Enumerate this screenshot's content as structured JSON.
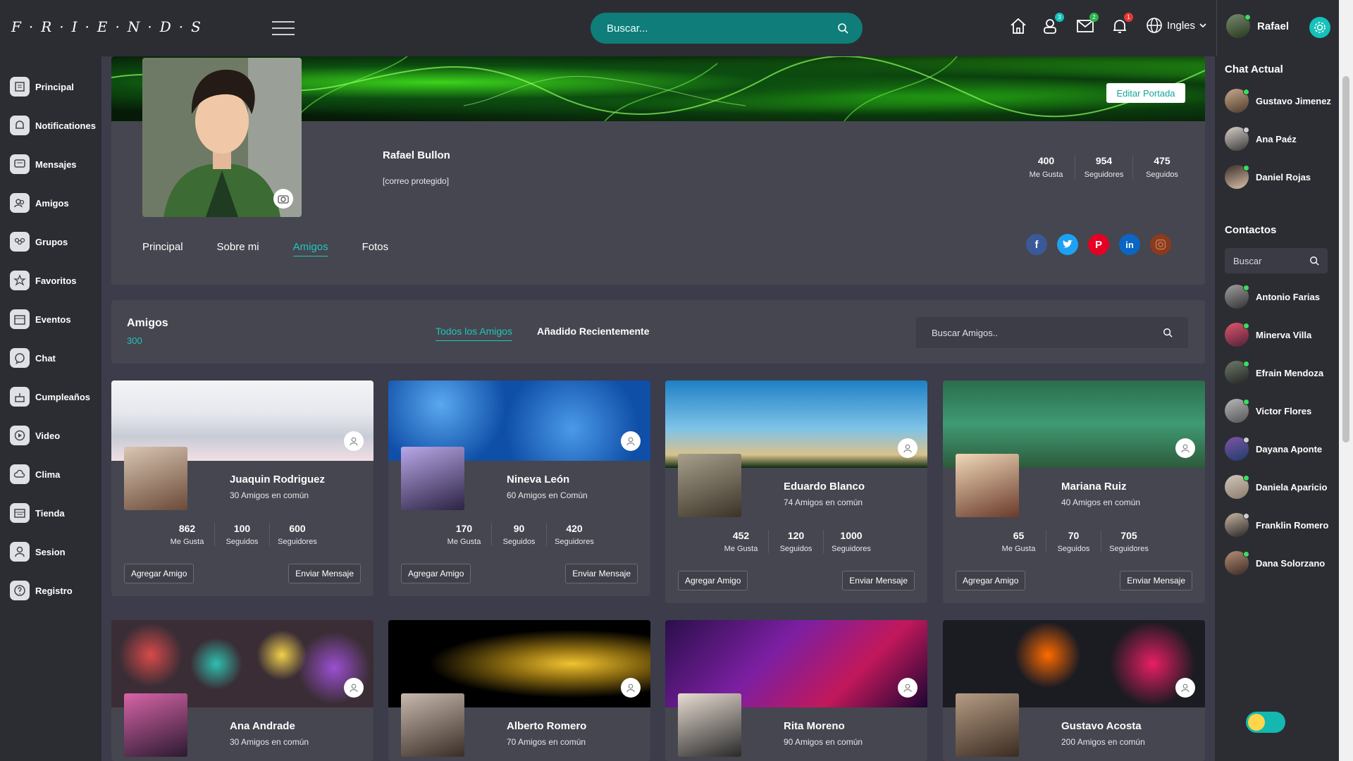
{
  "app": {
    "logo": "F·R·I·E·N·D·S"
  },
  "topbar": {
    "search_placeholder": "Buscar...",
    "badges": {
      "friends": "3",
      "messages": "2",
      "notifications": "1"
    },
    "language": "Ingles",
    "user_name": "Rafael"
  },
  "sidebar": {
    "items": [
      {
        "label": "Principal",
        "icon": "home-icon"
      },
      {
        "label": "Notificationes",
        "icon": "bell-icon"
      },
      {
        "label": "Mensajes",
        "icon": "message-icon"
      },
      {
        "label": "Amigos",
        "icon": "friends-icon"
      },
      {
        "label": "Grupos",
        "icon": "groups-icon"
      },
      {
        "label": "Favoritos",
        "icon": "star-icon"
      },
      {
        "label": "Eventos",
        "icon": "calendar-icon"
      },
      {
        "label": "Chat",
        "icon": "chat-icon"
      },
      {
        "label": "Cumpleaños",
        "icon": "cake-icon"
      },
      {
        "label": "Video",
        "icon": "video-icon"
      },
      {
        "label": "Clima",
        "icon": "weather-icon"
      },
      {
        "label": "Tienda",
        "icon": "store-icon"
      },
      {
        "label": "Sesion",
        "icon": "user-icon"
      },
      {
        "label": "Registro",
        "icon": "help-icon"
      }
    ]
  },
  "profile": {
    "edit_cover_label": "Editar Portada",
    "name": "Rafael Bullon",
    "email": "[correo protegido]",
    "stats": [
      {
        "value": "400",
        "label": "Me Gusta"
      },
      {
        "value": "954",
        "label": "Seguidores"
      },
      {
        "value": "475",
        "label": "Seguidos"
      }
    ],
    "tabs": [
      "Principal",
      "Sobre mi",
      "Amigos",
      "Fotos"
    ],
    "active_tab": "Amigos"
  },
  "friends_header": {
    "title": "Amigos",
    "count": "300",
    "tab_all": "Todos los Amigos",
    "tab_recent": "Añadido Recientemente",
    "search_placeholder": "Buscar Amigos.."
  },
  "friends": [
    {
      "name": "Juaquin Rodriguez",
      "common": "30 Amigos en común",
      "stats": [
        {
          "value": "862",
          "label": "Me Gusta"
        },
        {
          "value": "100",
          "label": "Seguidos"
        },
        {
          "value": "600",
          "label": "Seguidores"
        }
      ],
      "add": "Agregar Amigo",
      "msg": "Enviar Mensaje"
    },
    {
      "name": "Nineva León",
      "common": "60 Amigos en Común",
      "stats": [
        {
          "value": "170",
          "label": "Me Gusta"
        },
        {
          "value": "90",
          "label": "Seguidos"
        },
        {
          "value": "420",
          "label": "Seguidores"
        }
      ],
      "add": "Agregar Amigo",
      "msg": "Enviar Mensaje"
    },
    {
      "name": "Eduardo Blanco",
      "common": "74 Amigos en común",
      "stats": [
        {
          "value": "452",
          "label": "Me Gusta"
        },
        {
          "value": "120",
          "label": "Seguidos"
        },
        {
          "value": "1000",
          "label": "Seguidores"
        }
      ],
      "add": "Agregar Amigo",
      "msg": "Enviar Mensaje"
    },
    {
      "name": "Mariana Ruiz",
      "common": "40 Amigos en común",
      "stats": [
        {
          "value": "65",
          "label": "Me Gusta"
        },
        {
          "value": "70",
          "label": "Seguidos"
        },
        {
          "value": "705",
          "label": "Seguidores"
        }
      ],
      "add": "Agregar Amigo",
      "msg": "Enviar Mensaje"
    },
    {
      "name": "Ana Andrade",
      "common": "30 Amigos en común"
    },
    {
      "name": "Alberto Romero",
      "common": "70 Amigos en común"
    },
    {
      "name": "Rita Moreno",
      "common": "90 Amigos en común"
    },
    {
      "name": "Gustavo Acosta",
      "common": "200 Amigos en común"
    }
  ],
  "rightbar": {
    "chat_title": "Chat Actual",
    "chat": [
      {
        "name": "Gustavo Jimenez",
        "online": true
      },
      {
        "name": "Ana Paéz",
        "online": false
      },
      {
        "name": "Daniel Rojas",
        "online": true
      }
    ],
    "contacts_title": "Contactos",
    "search_placeholder": "Buscar",
    "contacts": [
      {
        "name": "Antonio Farias",
        "online": true
      },
      {
        "name": "Minerva Villa",
        "online": true
      },
      {
        "name": "Efrain Mendoza",
        "online": true
      },
      {
        "name": "Victor Flores",
        "online": true
      },
      {
        "name": "Dayana Aponte",
        "online": false
      },
      {
        "name": "Daniela Aparicio",
        "online": true
      },
      {
        "name": "Franklin Romero",
        "online": false
      },
      {
        "name": "Dana Solorzano",
        "online": true
      }
    ]
  },
  "colors": {
    "accent": "#14c2bb",
    "online": "#3adf5b",
    "panel": "#45464f",
    "bar": "#2c2d33"
  }
}
